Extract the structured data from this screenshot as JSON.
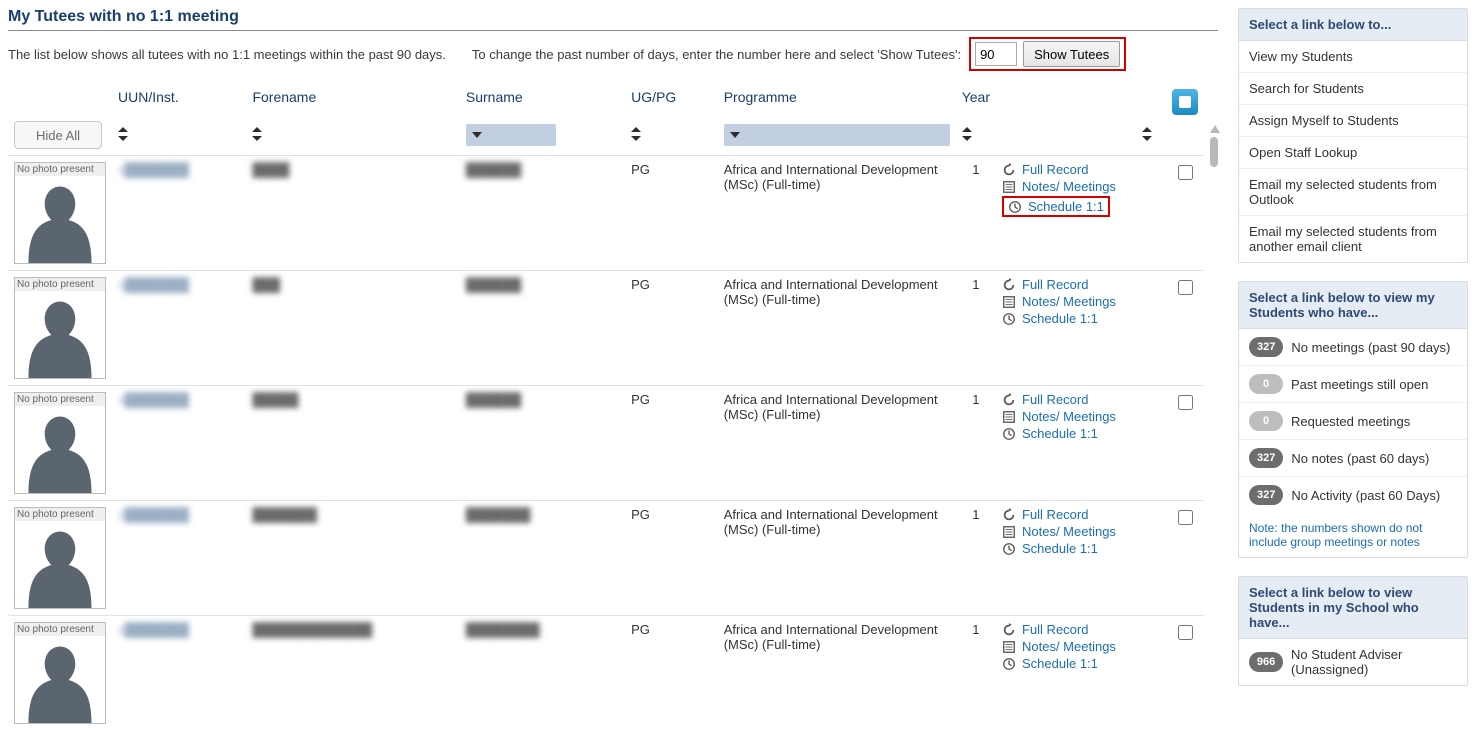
{
  "title": "My Tutees with no 1:1 meeting",
  "intro_part1": "The list below shows all tutees with no 1:1 meetings within the past 90 days.",
  "intro_part2": "To change the past number of days, enter the number here and select 'Show Tutees':",
  "days_value": "90",
  "show_tutees_label": "Show Tutees",
  "hide_all_label": "Hide All",
  "no_photo_label": "No photo present",
  "columns": {
    "uun": "UUN/Inst.",
    "forename": "Forename",
    "surname": "Surname",
    "ugpg": "UG/PG",
    "programme": "Programme",
    "year": "Year"
  },
  "action_labels": {
    "full_record": "Full Record",
    "notes_meetings": "Notes/ Meetings",
    "schedule": "Schedule 1:1"
  },
  "rows": [
    {
      "uun": "s███████",
      "forename": "████",
      "surname": "██████",
      "ugpg": "PG",
      "programme": "Africa and International Development (MSc) (Full-time)",
      "year": "1",
      "schedule_hi": true
    },
    {
      "uun": "s███████",
      "forename": "███",
      "surname": "██████",
      "ugpg": "PG",
      "programme": "Africa and International Development (MSc) (Full-time)",
      "year": "1",
      "schedule_hi": false
    },
    {
      "uun": "s███████",
      "forename": "█████",
      "surname": "██████",
      "ugpg": "PG",
      "programme": "Africa and International Development (MSc) (Full-time)",
      "year": "1",
      "schedule_hi": false
    },
    {
      "uun": "s███████",
      "forename": "███████",
      "surname": "███████",
      "ugpg": "PG",
      "programme": "Africa and International Development (MSc) (Full-time)",
      "year": "1",
      "schedule_hi": false
    },
    {
      "uun": "s███████",
      "forename": "█████████████",
      "surname": "████████",
      "ugpg": "PG",
      "programme": "Africa and International Development (MSc) (Full-time)",
      "year": "1",
      "schedule_hi": false
    }
  ],
  "sidebar": {
    "links_header": "Select a link below to...",
    "links": [
      "View my Students",
      "Search for Students",
      "Assign Myself to Students",
      "Open Staff Lookup",
      "Email my selected students from Outlook",
      "Email my selected students from another email client"
    ],
    "filters_header": "Select a link below to view my Students who have...",
    "filters": [
      {
        "count": "327",
        "label": "No meetings (past 90 days)",
        "zero": false
      },
      {
        "count": "0",
        "label": "Past meetings still open",
        "zero": true
      },
      {
        "count": "0",
        "label": "Requested meetings",
        "zero": true
      },
      {
        "count": "327",
        "label": "No notes (past 60 days)",
        "zero": false
      },
      {
        "count": "327",
        "label": "No Activity (past 60 Days)",
        "zero": false
      }
    ],
    "filters_note": "Note: the numbers shown do not include group meetings or notes",
    "school_header": "Select a link below to view Students in my School who have...",
    "school": [
      {
        "count": "966",
        "label": "No Student Adviser (Unassigned)",
        "zero": false
      }
    ]
  }
}
